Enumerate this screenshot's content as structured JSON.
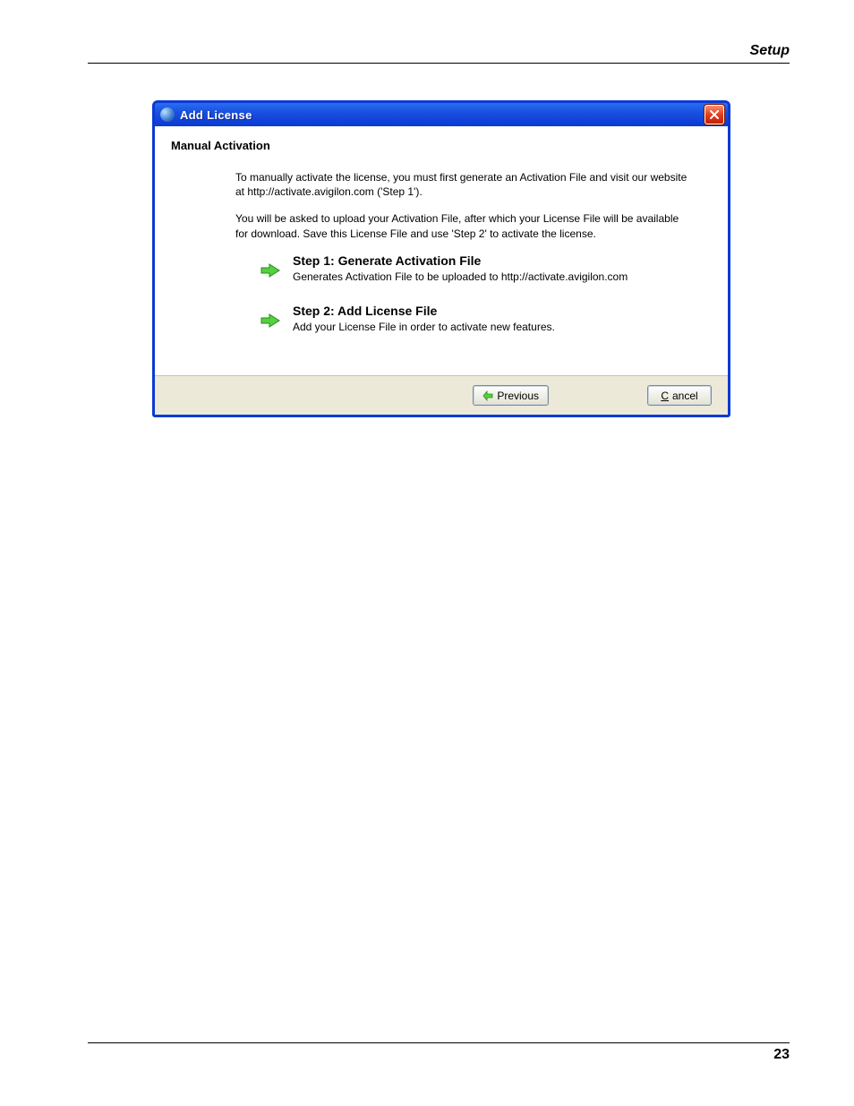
{
  "page": {
    "header": "Setup",
    "page_number": "23"
  },
  "dialog": {
    "title": "Add License",
    "section_title": "Manual Activation",
    "intro1": "To manually activate the license, you must first generate an Activation File and visit our website at http://activate.avigilon.com ('Step 1').",
    "intro2": "You will be asked to upload your Activation File, after which your License File will be available for download. Save this License File and use 'Step 2' to activate the license.",
    "step1": {
      "title": "Step 1: Generate Activation File",
      "desc": "Generates Activation File to be uploaded to http://activate.avigilon.com"
    },
    "step2": {
      "title": "Step 2: Add License File",
      "desc": "Add your License File in order to activate new features."
    },
    "buttons": {
      "previous": "Previous",
      "cancel_first": "C",
      "cancel_rest": "ancel"
    }
  }
}
